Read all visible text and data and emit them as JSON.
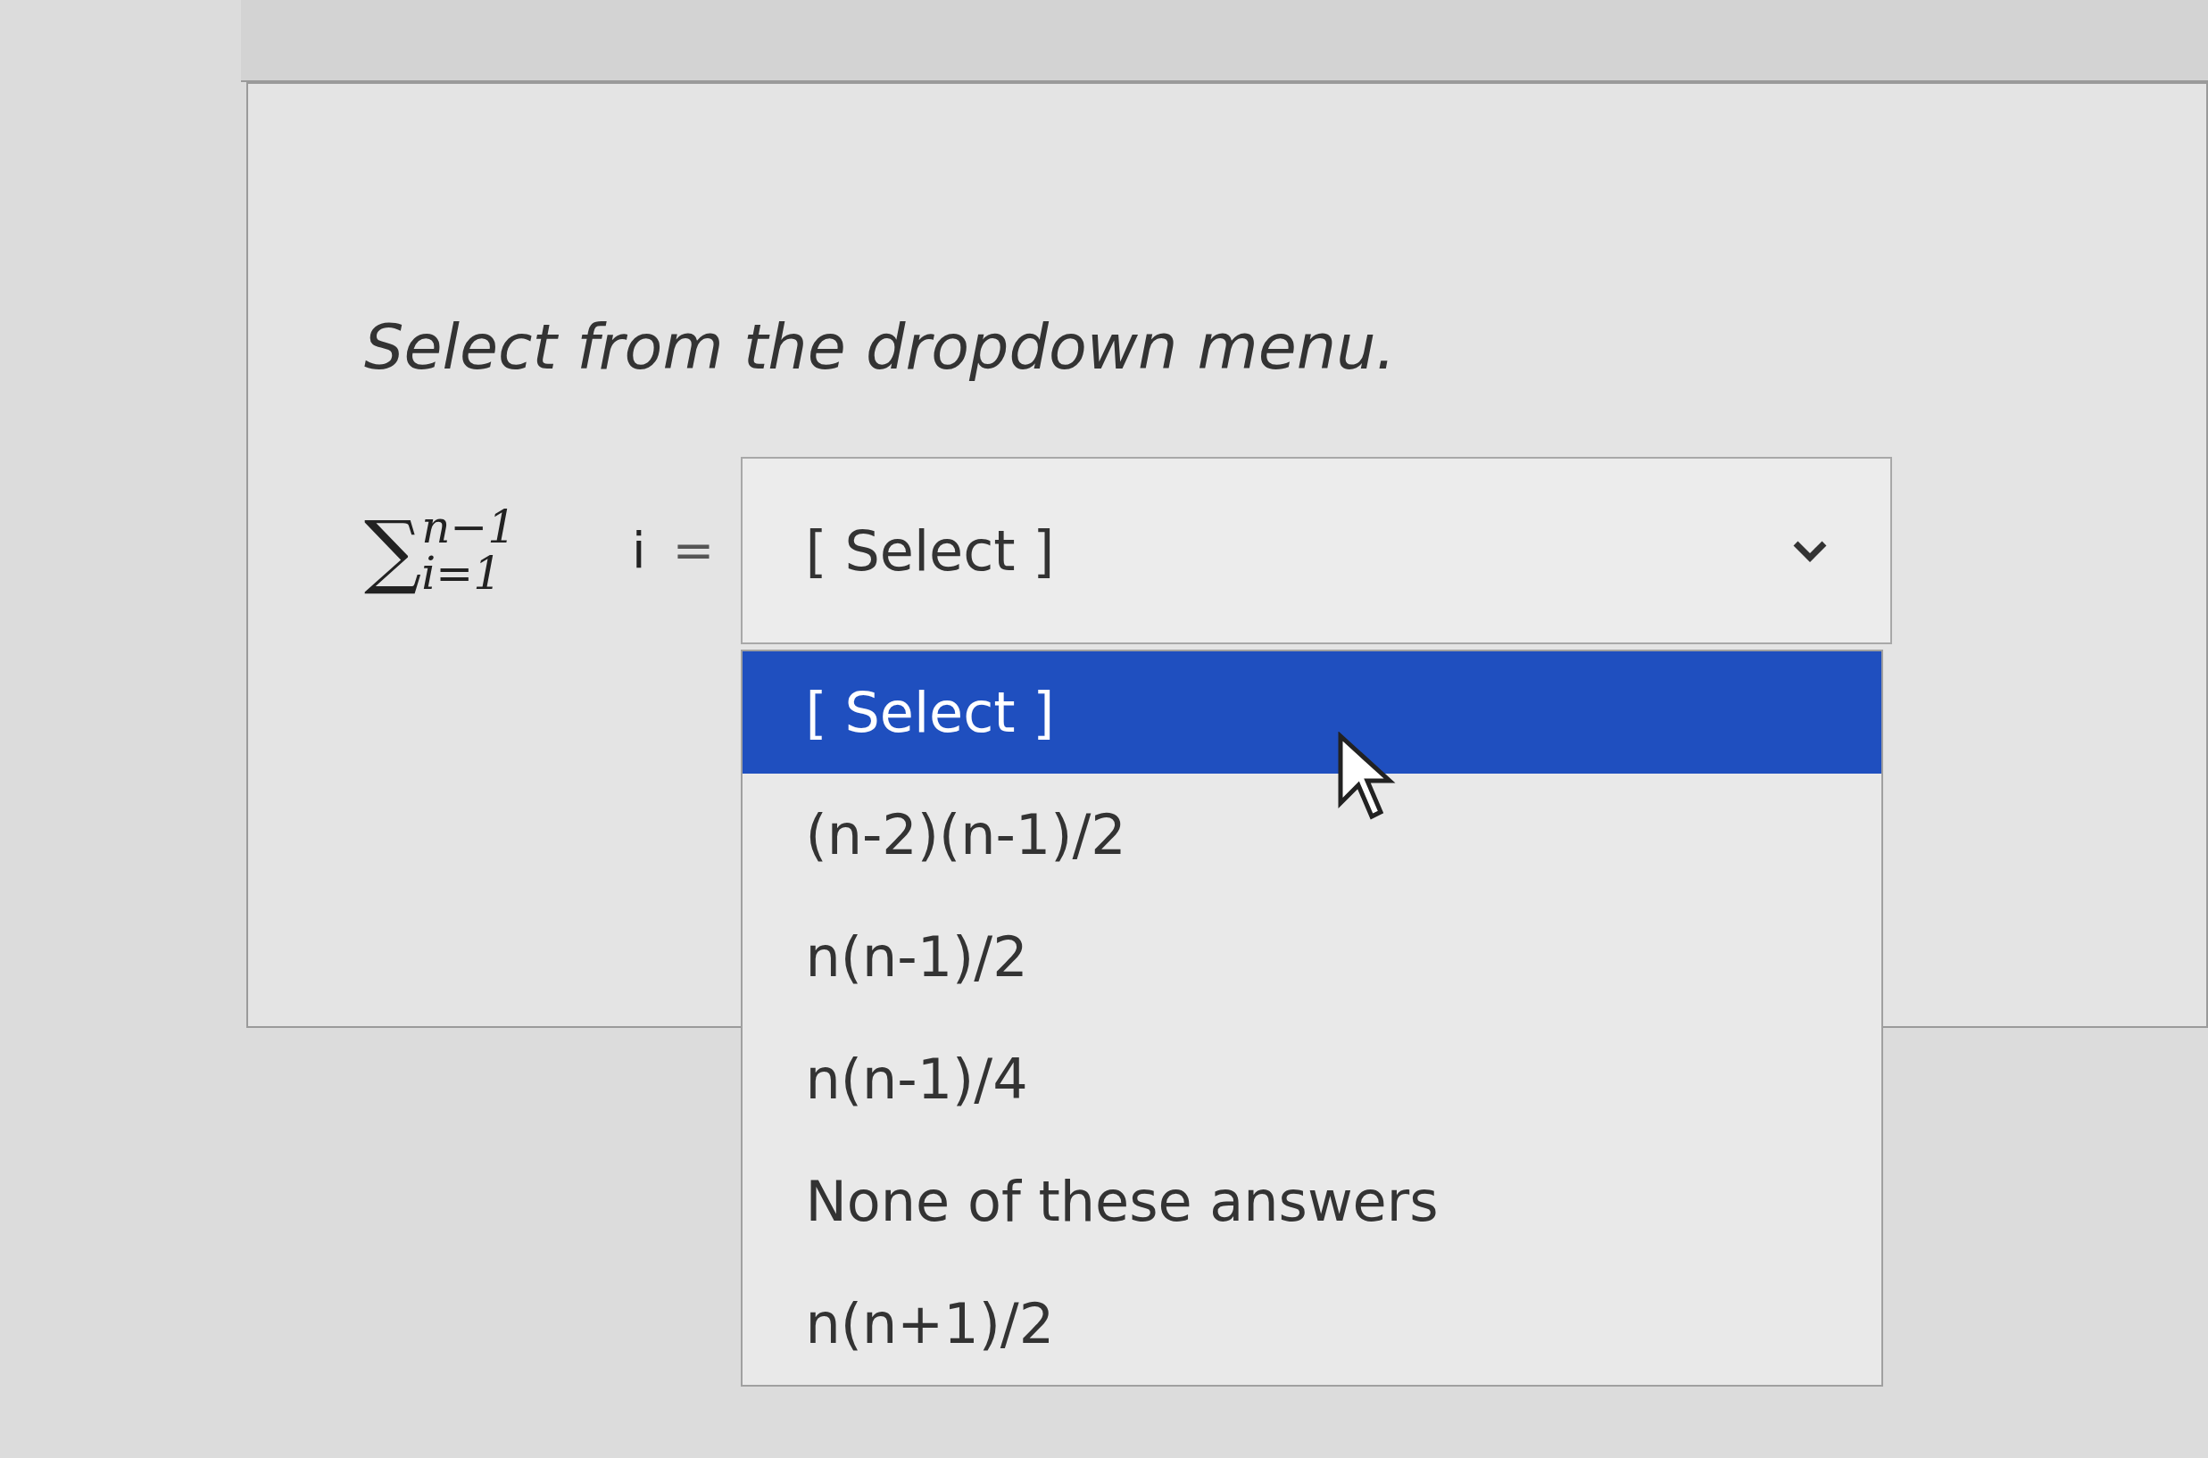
{
  "prompt": "Select from the dropdown menu.",
  "equation": {
    "symbol": "∑",
    "upper": "n−1",
    "lower": "i=1",
    "term": "i",
    "equals": "="
  },
  "dropdown": {
    "value": "[ Select ]",
    "expanded": true,
    "options": [
      {
        "label": "[ Select ]",
        "selected": true
      },
      {
        "label": "(n-2)(n-1)/2",
        "selected": false
      },
      {
        "label": "n(n-1)/2",
        "selected": false
      },
      {
        "label": "n(n-1)/4",
        "selected": false
      },
      {
        "label": "None of these answers",
        "selected": false
      },
      {
        "label": "n(n+1)/2",
        "selected": false
      }
    ]
  }
}
